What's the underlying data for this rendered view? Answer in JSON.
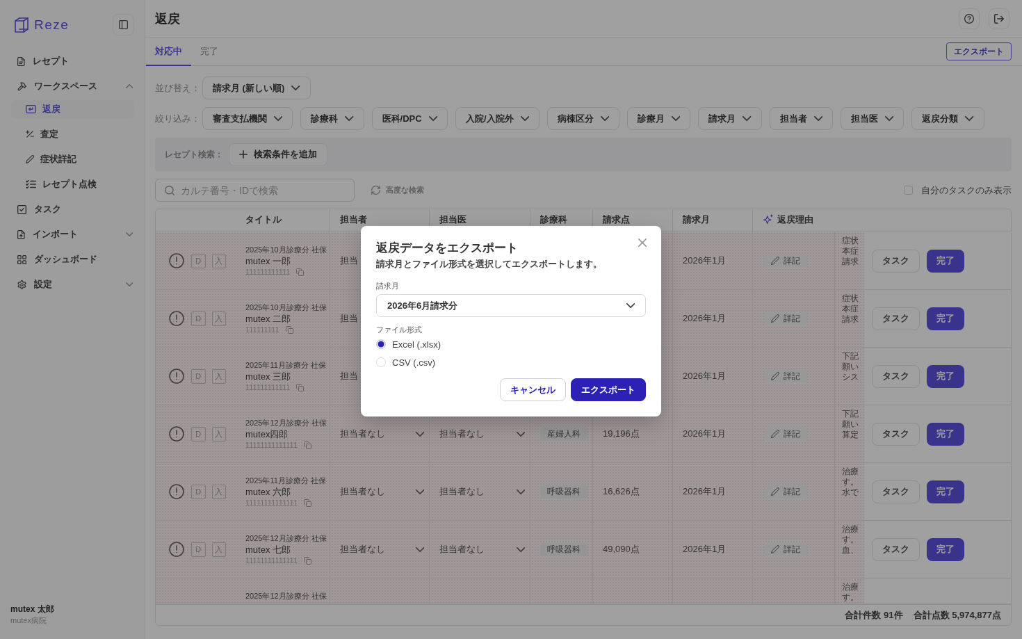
{
  "sidebar": {
    "brand": "Reze",
    "nav": [
      {
        "label": "レセプト",
        "selected": false
      },
      {
        "label": "ワークスペース",
        "selected": false,
        "expanded": true,
        "children": [
          {
            "label": "返戻",
            "selected": true
          },
          {
            "label": "査定",
            "selected": false
          },
          {
            "label": "症状詳記",
            "selected": false
          },
          {
            "label": "レセプト点検",
            "selected": false
          }
        ]
      },
      {
        "label": "タスク",
        "selected": false
      },
      {
        "label": "インポート",
        "selected": false,
        "expanded": false
      },
      {
        "label": "ダッシュボード",
        "selected": false
      },
      {
        "label": "設定",
        "selected": false,
        "expanded": false
      }
    ],
    "user": {
      "name": "mutex 太郎",
      "organization": "mutex病院"
    }
  },
  "header": {
    "title": "返戻"
  },
  "tabs": [
    {
      "label": "対応中",
      "selected": true
    },
    {
      "label": "完了",
      "selected": false
    }
  ],
  "export_button": "エクスポート",
  "sort": {
    "label": "並び替え：",
    "value": "請求月 (新しい順)"
  },
  "filters": {
    "label": "絞り込み：",
    "dropdowns": [
      "審査支払機関",
      "診療科",
      "医科/DPC",
      "入院/入院外",
      "病棟区分",
      "診療月",
      "請求月",
      "担当者",
      "担当医",
      "返戻分類"
    ]
  },
  "receipt_search": {
    "label": "レセプト検索：",
    "add_button": "検索条件を追加"
  },
  "search_row": {
    "placeholder": "カルテ番号・IDで検索",
    "advanced_search": "高度な検索",
    "my_tasks": {
      "label": "自分のタスクのみ表示",
      "checked": false
    }
  },
  "table": {
    "columns": [
      "タイトル",
      "担当者",
      "担当医",
      "診療科",
      "請求点",
      "請求月",
      "返戻理由"
    ],
    "rows": [
      {
        "highlighted": true,
        "badges": [
          "D",
          "入"
        ],
        "title": "2025年10月診療分 社保",
        "name": "mutex 一郎",
        "id": "111111111111",
        "assignee": {
          "value": "担当"
        },
        "billing_month": "2026年1月",
        "detail_button": "詳記",
        "reason_lines": [
          "症状",
          "本症",
          "請求"
        ],
        "actions": [
          {
            "label": "タスク",
            "kind": "secondary"
          },
          {
            "label": "完了",
            "kind": "primary"
          }
        ]
      },
      {
        "highlighted": true,
        "badges": [
          "D",
          "入"
        ],
        "title": "2025年10月診療分 社保",
        "name": "mutex 二郎",
        "id": "111111111",
        "assignee": {
          "value": "担当"
        },
        "billing_month": "2026年1月",
        "detail_button": "詳記",
        "reason_lines": [
          "症状",
          "本症",
          "請求"
        ],
        "actions": [
          {
            "label": "タスク",
            "kind": "secondary"
          },
          {
            "label": "完了",
            "kind": "primary"
          }
        ]
      },
      {
        "highlighted": true,
        "badges": [
          "D",
          "入"
        ],
        "title": "2025年11月診療分 社保",
        "name": "mutex 三郎",
        "id": "111111111111",
        "assignee": {
          "value": "担当"
        },
        "billing_month": "2026年1月",
        "detail_button": "詳記",
        "reason_lines": [
          "下記",
          "願い",
          "シス"
        ],
        "actions": [
          {
            "label": "タスク",
            "kind": "secondary"
          },
          {
            "label": "完了",
            "kind": "primary"
          }
        ]
      },
      {
        "highlighted": true,
        "badges": [
          "D",
          "入"
        ],
        "title": "2025年12月診療分 社保",
        "name": "mutex四郎",
        "id": "11111111111111",
        "assignee": {
          "value": "担当者なし",
          "dropdown": true
        },
        "doctor": {
          "value": "担当者なし",
          "dropdown": true
        },
        "department": "産婦人科",
        "points": "19,196点",
        "billing_month": "2026年1月",
        "detail_button": "詳記",
        "reason_lines": [
          "下記",
          "願い",
          "算定"
        ],
        "actions": [
          {
            "label": "タスク",
            "kind": "secondary"
          },
          {
            "label": "完了",
            "kind": "primary"
          }
        ]
      },
      {
        "highlighted": true,
        "badges": [
          "D",
          "入"
        ],
        "title": "2025年11月診療分 社保",
        "name": "mutex 六郎",
        "id": "11111111111111",
        "assignee": {
          "value": "担当者なし",
          "dropdown": true
        },
        "doctor": {
          "value": "担当者なし",
          "dropdown": true
        },
        "department": "呼吸器科",
        "points": "16,626点",
        "billing_month": "2026年1月",
        "detail_button": "詳記",
        "reason_lines": [
          "治療",
          "す。",
          "水で"
        ],
        "actions": [
          {
            "label": "タスク",
            "kind": "secondary"
          },
          {
            "label": "完了",
            "kind": "primary"
          }
        ]
      },
      {
        "highlighted": true,
        "badges": [
          "D",
          "入"
        ],
        "title": "2025年12月診療分 社保",
        "name": "mutex 七郎",
        "id": "11111111111111",
        "assignee": {
          "value": "担当者なし",
          "dropdown": true
        },
        "doctor": {
          "value": "担当者なし",
          "dropdown": true
        },
        "department": "呼吸器科",
        "points": "49,090点",
        "billing_month": "2026年1月",
        "detail_button": "詳記",
        "reason_lines": [
          "治療",
          "す。",
          "血、"
        ],
        "actions": [
          {
            "label": "タスク",
            "kind": "secondary"
          },
          {
            "label": "完了",
            "kind": "primary"
          }
        ]
      },
      {
        "highlighted": true,
        "title": "2025年12月診療分 社保",
        "reason_lines": [
          "治療",
          "す。"
        ]
      }
    ],
    "footer": {
      "count": "合計件数 91件",
      "total_points": "合計点数 5,974,877点"
    }
  },
  "export_dialog": {
    "title": "返戻データをエクスポート",
    "description": "請求月とファイル形式を選択してエクスポートします。",
    "month_label": "請求月",
    "month_value": "2026年6月請求分",
    "format_label": "ファイル形式",
    "formats": [
      {
        "label": "Excel (.xlsx)",
        "selected": true
      },
      {
        "label": "CSV (.csv)",
        "selected": false
      }
    ],
    "buttons": [
      {
        "label": "キャンセル",
        "kind": "secondary"
      },
      {
        "label": "エクスポート",
        "kind": "primary"
      }
    ]
  }
}
